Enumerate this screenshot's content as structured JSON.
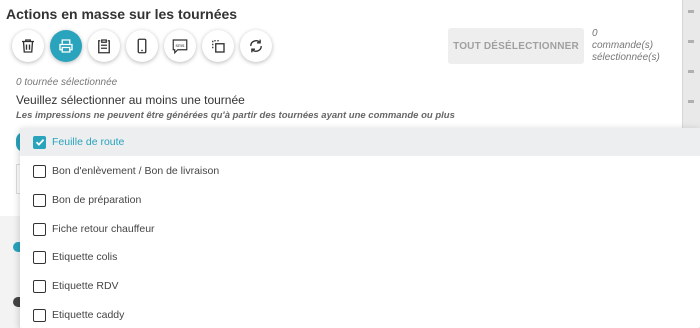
{
  "header": {
    "title": "Actions en masse sur les tournées"
  },
  "toolbar": {
    "icons": [
      "trash-icon",
      "printer-icon",
      "clipboard-icon",
      "phone-icon",
      "sms-icon",
      "copy-icon",
      "refresh-icon"
    ],
    "active_icon": "printer-icon",
    "sms_text": "sms",
    "deselect_label": "TOUT DÉSÉLECTIONNER",
    "selected_count_line1": "0",
    "selected_count_line2": "commande(s)",
    "selected_count_line3": "sélectionnée(s)"
  },
  "status": {
    "none_selected": "0 tournée sélectionnée",
    "warning": "Veuillez sélectionner au moins une tournée",
    "note": "Les impressions ne peuvent être générées qu'à partir des tournées ayant une commande ou plus"
  },
  "dropdown": {
    "options": [
      {
        "label": "Feuille de route",
        "checked": true
      },
      {
        "label": "Bon d'enlèvement / Bon de livraison",
        "checked": false
      },
      {
        "label": "Bon de préparation",
        "checked": false
      },
      {
        "label": "Fiche retour chauffeur",
        "checked": false
      },
      {
        "label": "Etiquette colis",
        "checked": false
      },
      {
        "label": "Etiquette RDV",
        "checked": false
      },
      {
        "label": "Etiquette caddy",
        "checked": false
      }
    ]
  },
  "colors": {
    "accent": "#2aa3bd",
    "text": "#333333",
    "muted": "#777777"
  }
}
